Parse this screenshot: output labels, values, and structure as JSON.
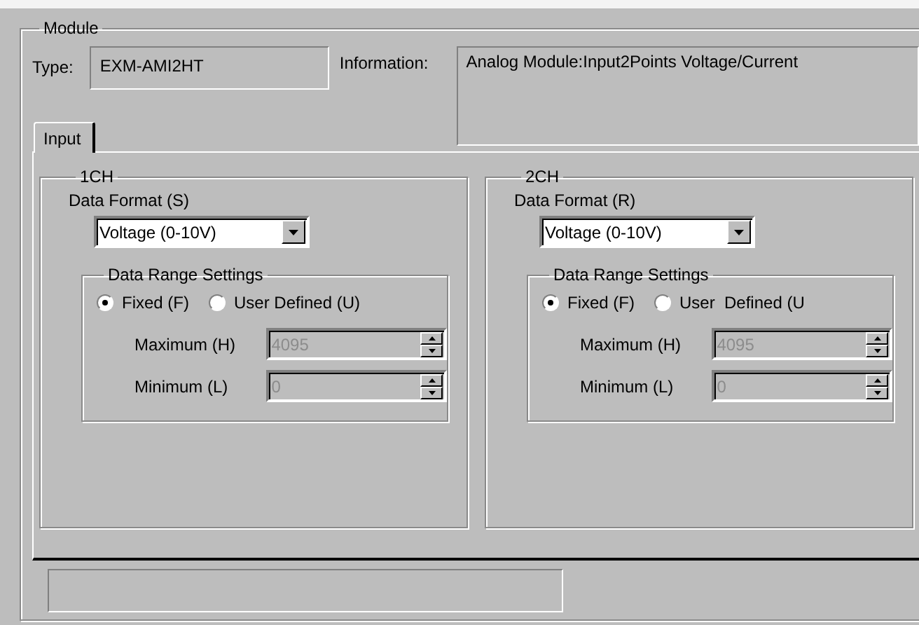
{
  "module": {
    "legend": "Module",
    "type_label": "Type:",
    "type_value": "EXM-AMI2HT",
    "information_label": "Information:",
    "information_value": "Analog Module:Input2Points Voltage/Current"
  },
  "tabs": [
    {
      "label": "Input",
      "selected": true
    }
  ],
  "channels": [
    {
      "legend": "1CH",
      "format_label": "Data Format (S)",
      "format_value": "Voltage (0-10V)",
      "range_legend": "Data Range Settings",
      "radios": [
        {
          "label": "Fixed (F)",
          "selected": true
        },
        {
          "label": "User Defined (U)",
          "selected": false
        }
      ],
      "fields": [
        {
          "label": "Maximum (H)",
          "value": "4095",
          "disabled": true
        },
        {
          "label": "Minimum (L)",
          "value": "0",
          "disabled": true
        }
      ]
    },
    {
      "legend": "2CH",
      "format_label": "Data Format (R)",
      "format_value": "Voltage (0-10V)",
      "range_legend": "Data Range Settings",
      "radios": [
        {
          "label": "Fixed (F)",
          "selected": true
        },
        {
          "label": "User  Defined (U",
          "selected": false
        }
      ],
      "fields": [
        {
          "label": "Maximum (H)",
          "value": "4095",
          "disabled": true
        },
        {
          "label": "Minimum (L)",
          "value": "0",
          "disabled": true
        }
      ]
    }
  ]
}
